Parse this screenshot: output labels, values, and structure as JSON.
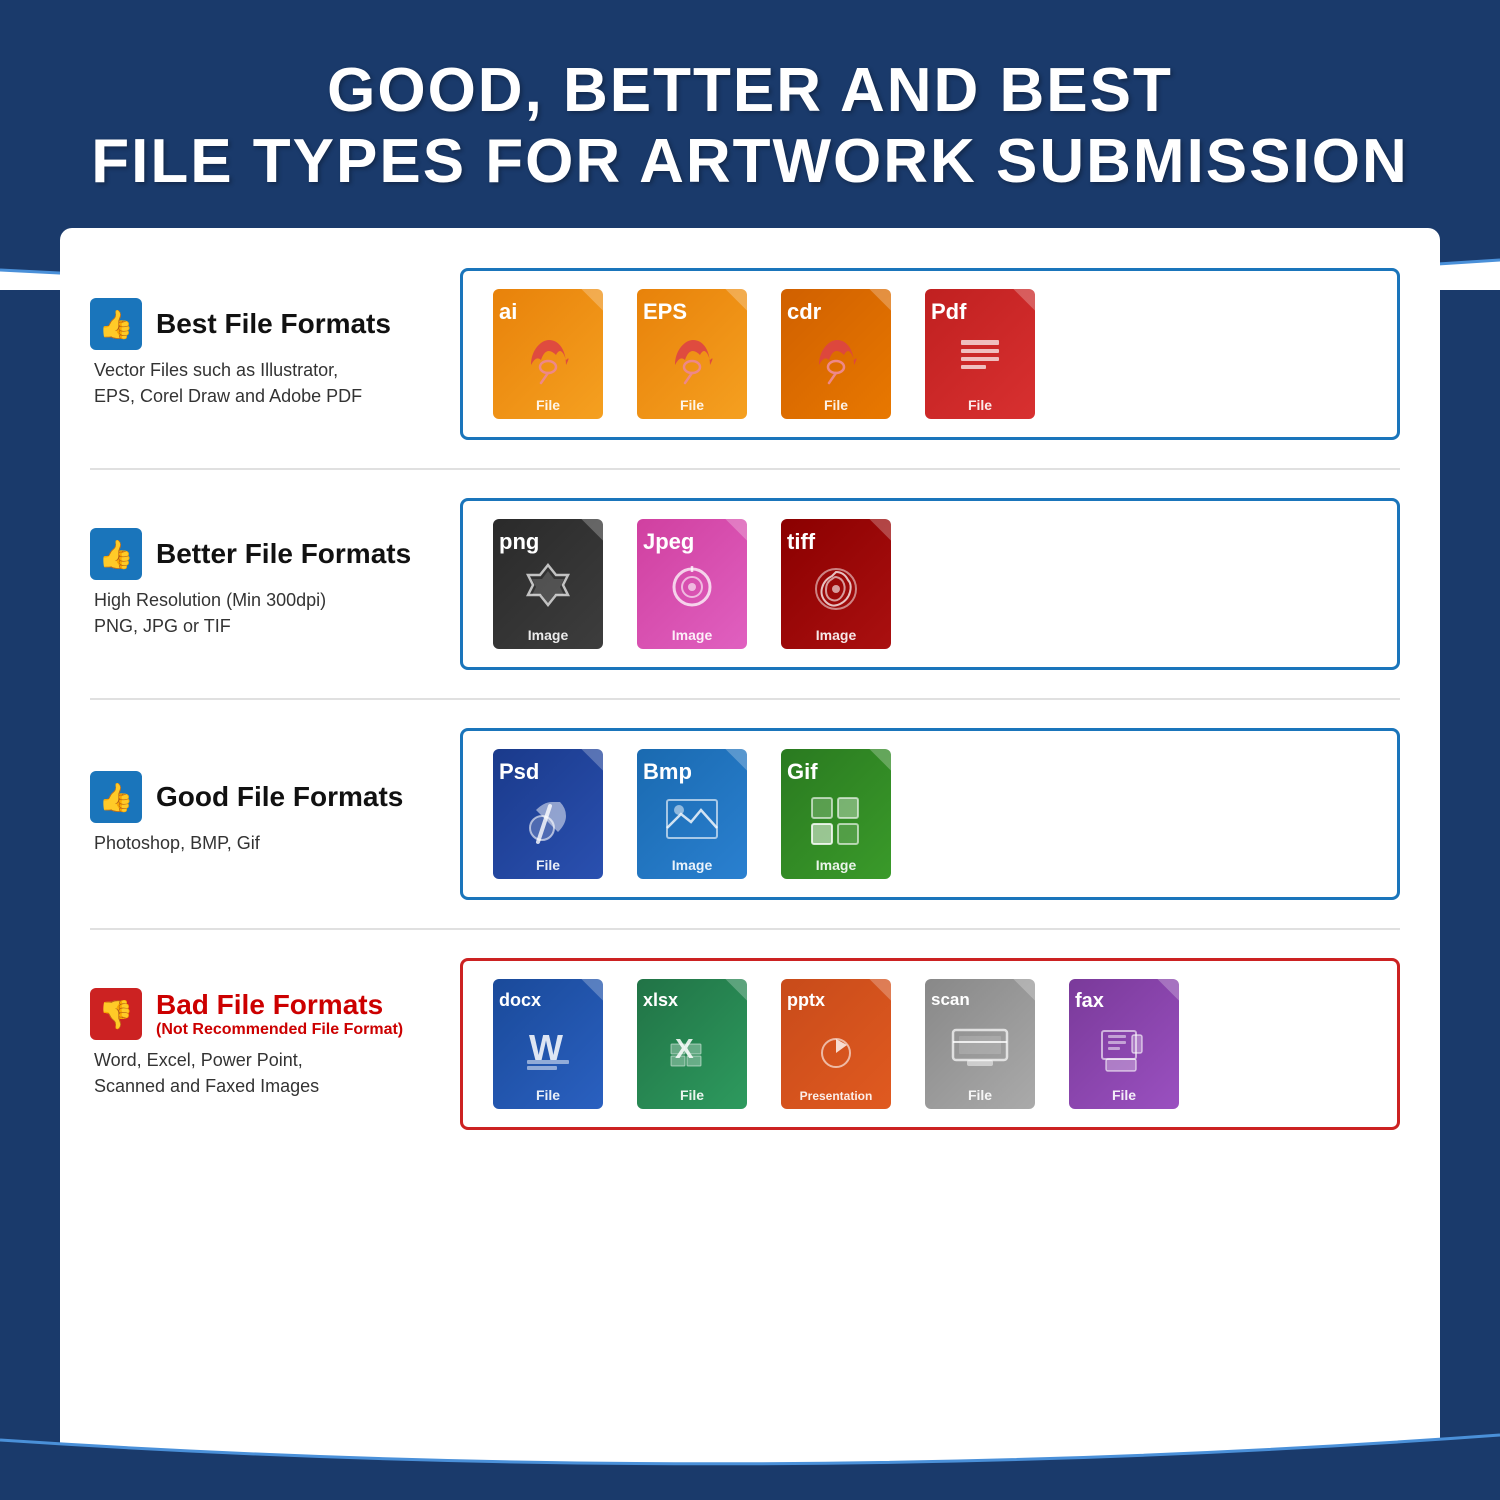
{
  "header": {
    "line1": "GOOD, BETTER AND BEST",
    "line2": "FILE TYPES FOR ARTWORK SUBMISSION"
  },
  "rows": [
    {
      "id": "best",
      "thumbsUp": true,
      "thumbsDown": false,
      "title": "Best File Formats",
      "subtitle": null,
      "description": "Vector Files such as Illustrator,\nEPS, Corel Draw and Adobe PDF",
      "borderColor": "#1a75bb",
      "files": [
        {
          "ext": "ai",
          "label": "File",
          "color": "orange",
          "icon": "pen"
        },
        {
          "ext": "EPS",
          "label": "File",
          "color": "orange",
          "icon": "pen"
        },
        {
          "ext": "cdr",
          "label": "File",
          "color": "dark-orange",
          "icon": "pen"
        },
        {
          "ext": "Pdf",
          "label": "File",
          "color": "red-file",
          "icon": "doc"
        }
      ]
    },
    {
      "id": "better",
      "thumbsUp": true,
      "thumbsDown": false,
      "title": "Better File Formats",
      "subtitle": null,
      "description": "High Resolution (Min 300dpi)\nPNG, JPG or TIF",
      "borderColor": "#1a75bb",
      "files": [
        {
          "ext": "png",
          "label": "Image",
          "color": "dark-gray",
          "icon": "star"
        },
        {
          "ext": "Jpeg",
          "label": "Image",
          "color": "pink",
          "icon": "camera"
        },
        {
          "ext": "tiff",
          "label": "Image",
          "color": "dark-red",
          "icon": "gear"
        }
      ]
    },
    {
      "id": "good",
      "thumbsUp": true,
      "thumbsDown": false,
      "title": "Good File Formats",
      "subtitle": null,
      "description": "Photoshop, BMP, Gif",
      "borderColor": "#1a75bb",
      "files": [
        {
          "ext": "Psd",
          "label": "File",
          "color": "dark-blue",
          "icon": "brush"
        },
        {
          "ext": "Bmp",
          "label": "Image",
          "color": "blue",
          "icon": "mountain"
        },
        {
          "ext": "Gif",
          "label": "Image",
          "color": "green-file",
          "icon": "grid"
        }
      ]
    },
    {
      "id": "bad",
      "thumbsUp": false,
      "thumbsDown": true,
      "title": "Bad File Formats",
      "subtitle": "(Not Recommended File Format)",
      "description": "Word, Excel, Power Point,\nScanned and Faxed Images",
      "borderColor": "#cc2222",
      "files": [
        {
          "ext": "docx",
          "label": "File",
          "color": "word-blue",
          "icon": "word"
        },
        {
          "ext": "xlsx",
          "label": "File",
          "color": "excel-green",
          "icon": "excel"
        },
        {
          "ext": "pptx",
          "label": "Presentation",
          "color": "ppt-red",
          "icon": "ppt"
        },
        {
          "ext": "scan",
          "label": "File",
          "color": "scan-gray",
          "icon": "scan"
        },
        {
          "ext": "fax",
          "label": "File",
          "color": "fax-purple",
          "icon": "fax"
        }
      ]
    }
  ]
}
